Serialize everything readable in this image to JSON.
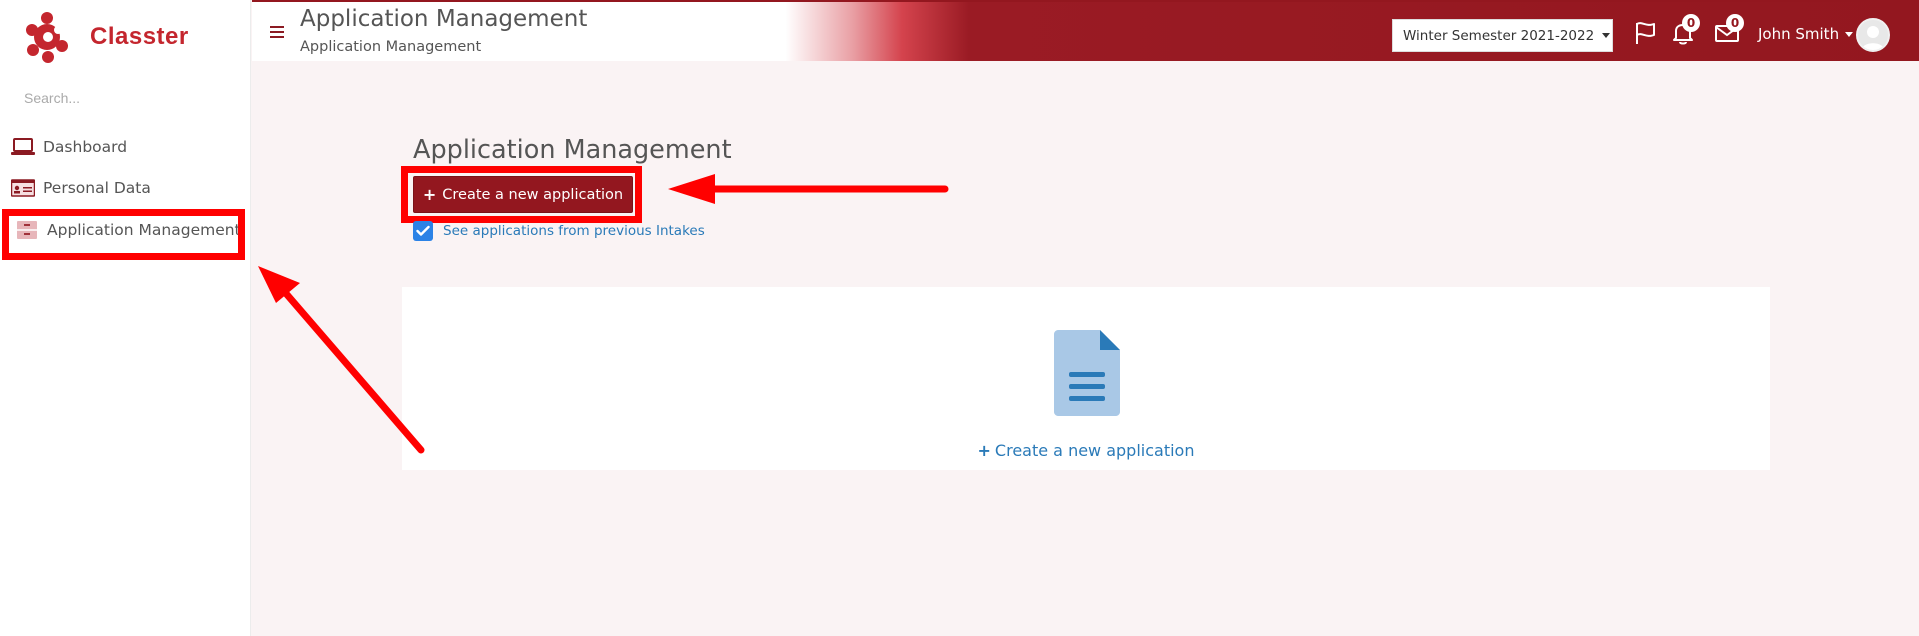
{
  "brand": {
    "name": "Classter",
    "accent": "#c4262e",
    "header_color": "#93171f"
  },
  "sidebar": {
    "search_placeholder": "Search...",
    "items": [
      {
        "label": "Dashboard",
        "icon": "laptop-icon"
      },
      {
        "label": "Personal Data",
        "icon": "id-card-icon"
      },
      {
        "label": "Application Management",
        "icon": "archive-icon"
      }
    ]
  },
  "header": {
    "title": "Application Management",
    "subtitle": "Application Management",
    "semester": "Winter Semester 2021-2022",
    "notifications_count": "0",
    "messages_count": "0",
    "user_name": "John Smith"
  },
  "main": {
    "title": "Application Management",
    "create_button": "Create a new application",
    "checkbox_label": "See applications from previous Intakes",
    "checkbox_checked": true,
    "empty_link": "Create a new application"
  },
  "annotations": {
    "highlight_color": "#ff0000"
  }
}
